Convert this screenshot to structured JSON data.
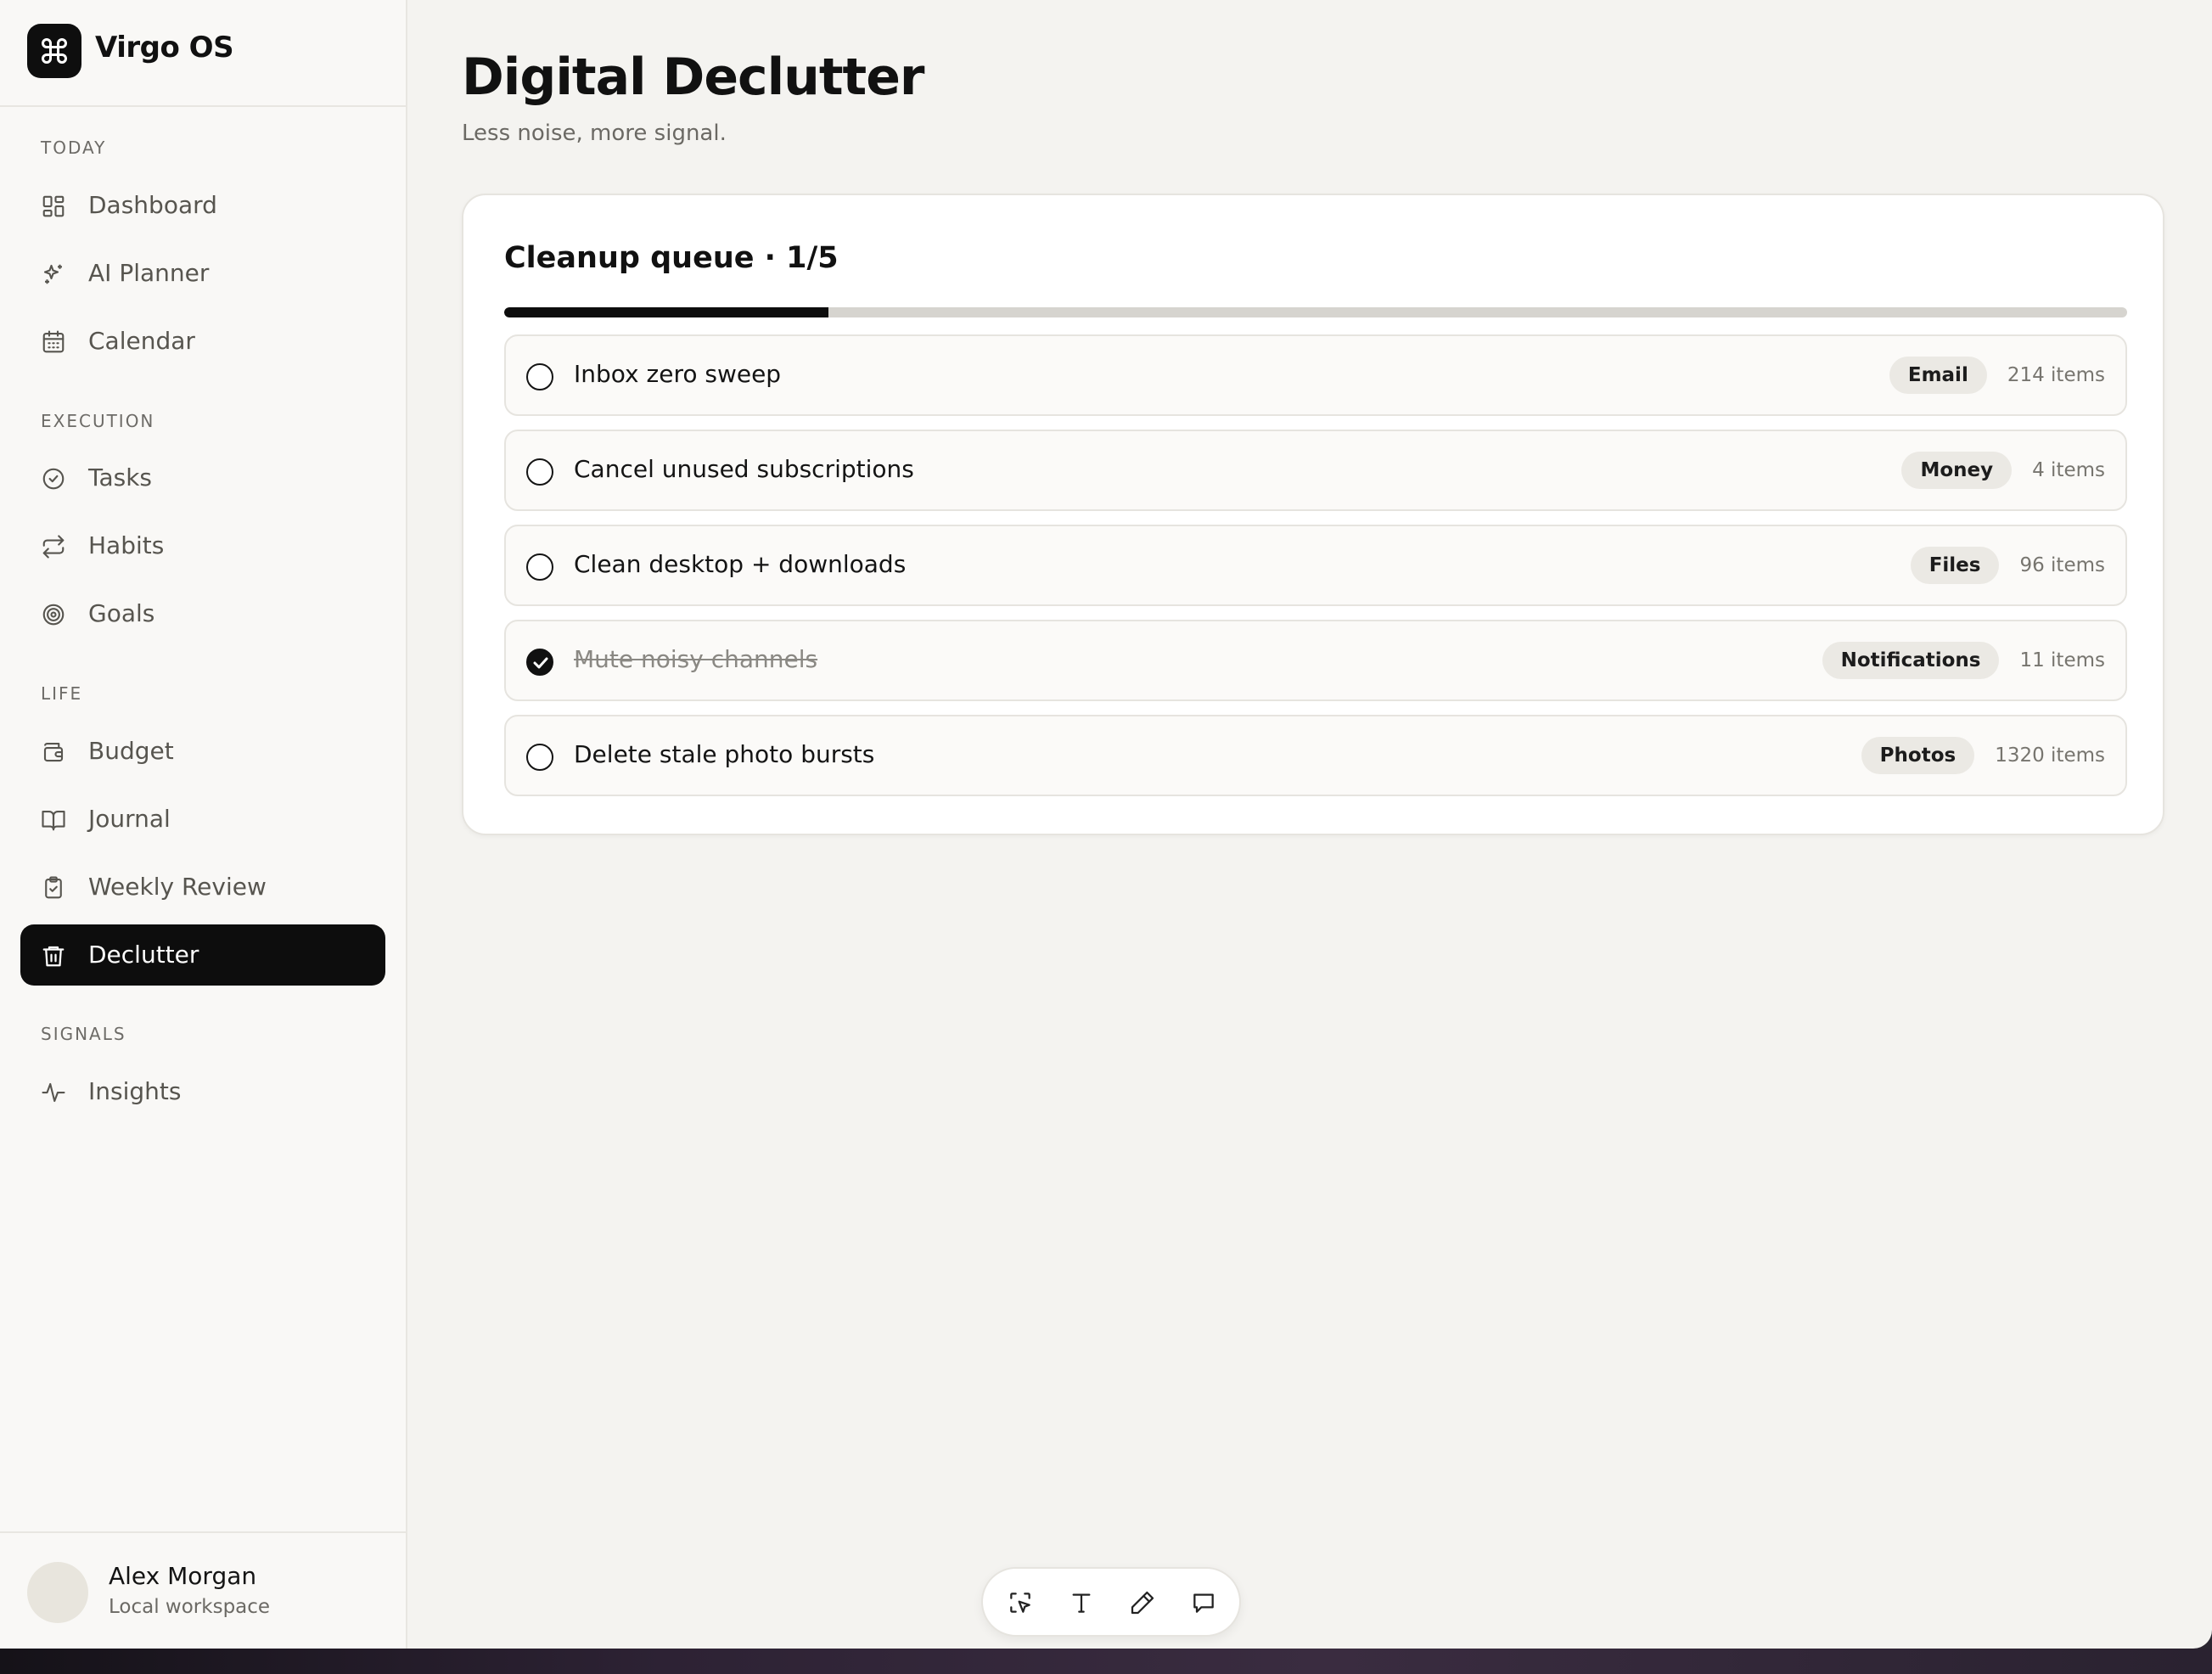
{
  "app": {
    "name": "Virgo OS"
  },
  "sidebar": {
    "sections": [
      {
        "label": "TODAY"
      },
      {
        "label": "EXECUTION"
      },
      {
        "label": "LIFE"
      },
      {
        "label": "SIGNALS"
      }
    ],
    "items": [
      {
        "label": "Dashboard",
        "icon": "grid-icon"
      },
      {
        "label": "AI Planner",
        "icon": "sparkles-icon"
      },
      {
        "label": "Calendar",
        "icon": "calendar-icon"
      },
      {
        "label": "Tasks",
        "icon": "check-circle-icon"
      },
      {
        "label": "Habits",
        "icon": "repeat-icon"
      },
      {
        "label": "Goals",
        "icon": "target-icon"
      },
      {
        "label": "Budget",
        "icon": "wallet-icon"
      },
      {
        "label": "Journal",
        "icon": "book-icon"
      },
      {
        "label": "Weekly Review",
        "icon": "clipboard-check-icon"
      },
      {
        "label": "Declutter",
        "icon": "trash-icon",
        "active": true
      },
      {
        "label": "Insights",
        "icon": "activity-icon"
      }
    ]
  },
  "user": {
    "name": "Alex Morgan",
    "workspace": "Local workspace"
  },
  "page": {
    "title": "Digital Declutter",
    "subtitle": "Less noise, more signal."
  },
  "queue": {
    "title": "Cleanup queue · 1/5",
    "progress": 0.2,
    "items": [
      {
        "title": "Inbox zero sweep",
        "tag": "Email",
        "count": "214 items",
        "done": false
      },
      {
        "title": "Cancel unused subscriptions",
        "tag": "Money",
        "count": "4 items",
        "done": false
      },
      {
        "title": "Clean desktop + downloads",
        "tag": "Files",
        "count": "96 items",
        "done": false
      },
      {
        "title": "Mute noisy channels",
        "tag": "Notifications",
        "count": "11 items",
        "done": true
      },
      {
        "title": "Delete stale photo bursts",
        "tag": "Photos",
        "count": "1320 items",
        "done": false
      }
    ]
  },
  "toolbar": {
    "tools": [
      "select-icon",
      "text-icon",
      "pencil-icon",
      "comment-icon"
    ]
  },
  "colors": {
    "accent": "#0d0d0d",
    "background": "#f4f3f0",
    "sidebar": "#f9f8f6"
  }
}
